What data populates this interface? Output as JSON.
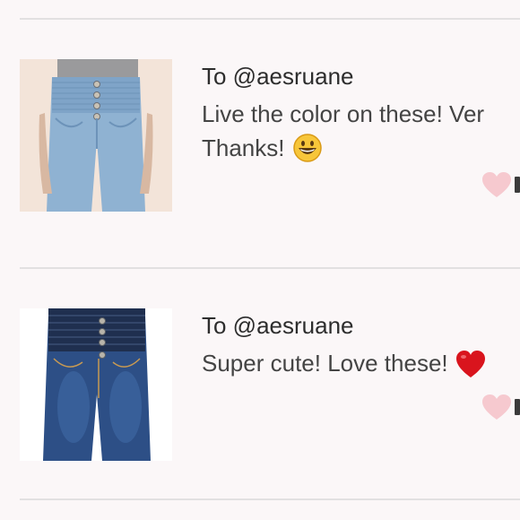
{
  "reviews": [
    {
      "recipient": "To @aesruane",
      "comment_line1": "Live the color on these! Ver",
      "comment_line2": "Thanks!",
      "emoji": "grinning-face-emoji",
      "photo": "light-wash-high-waist-jeans",
      "like_icon": "heart-icon"
    },
    {
      "recipient": "To @aesruane",
      "comment_line1": "Super cute! Love these!",
      "emoji": "red-heart-emoji",
      "photo": "dark-wash-high-waist-jeans",
      "like_icon": "heart-icon"
    }
  ],
  "colors": {
    "background": "#fbf7f8",
    "divider": "#e2e0e1",
    "like_heart": "#f6c9cf",
    "light_denim": "#8fb2d2",
    "dark_denim": "#2d4f86"
  }
}
